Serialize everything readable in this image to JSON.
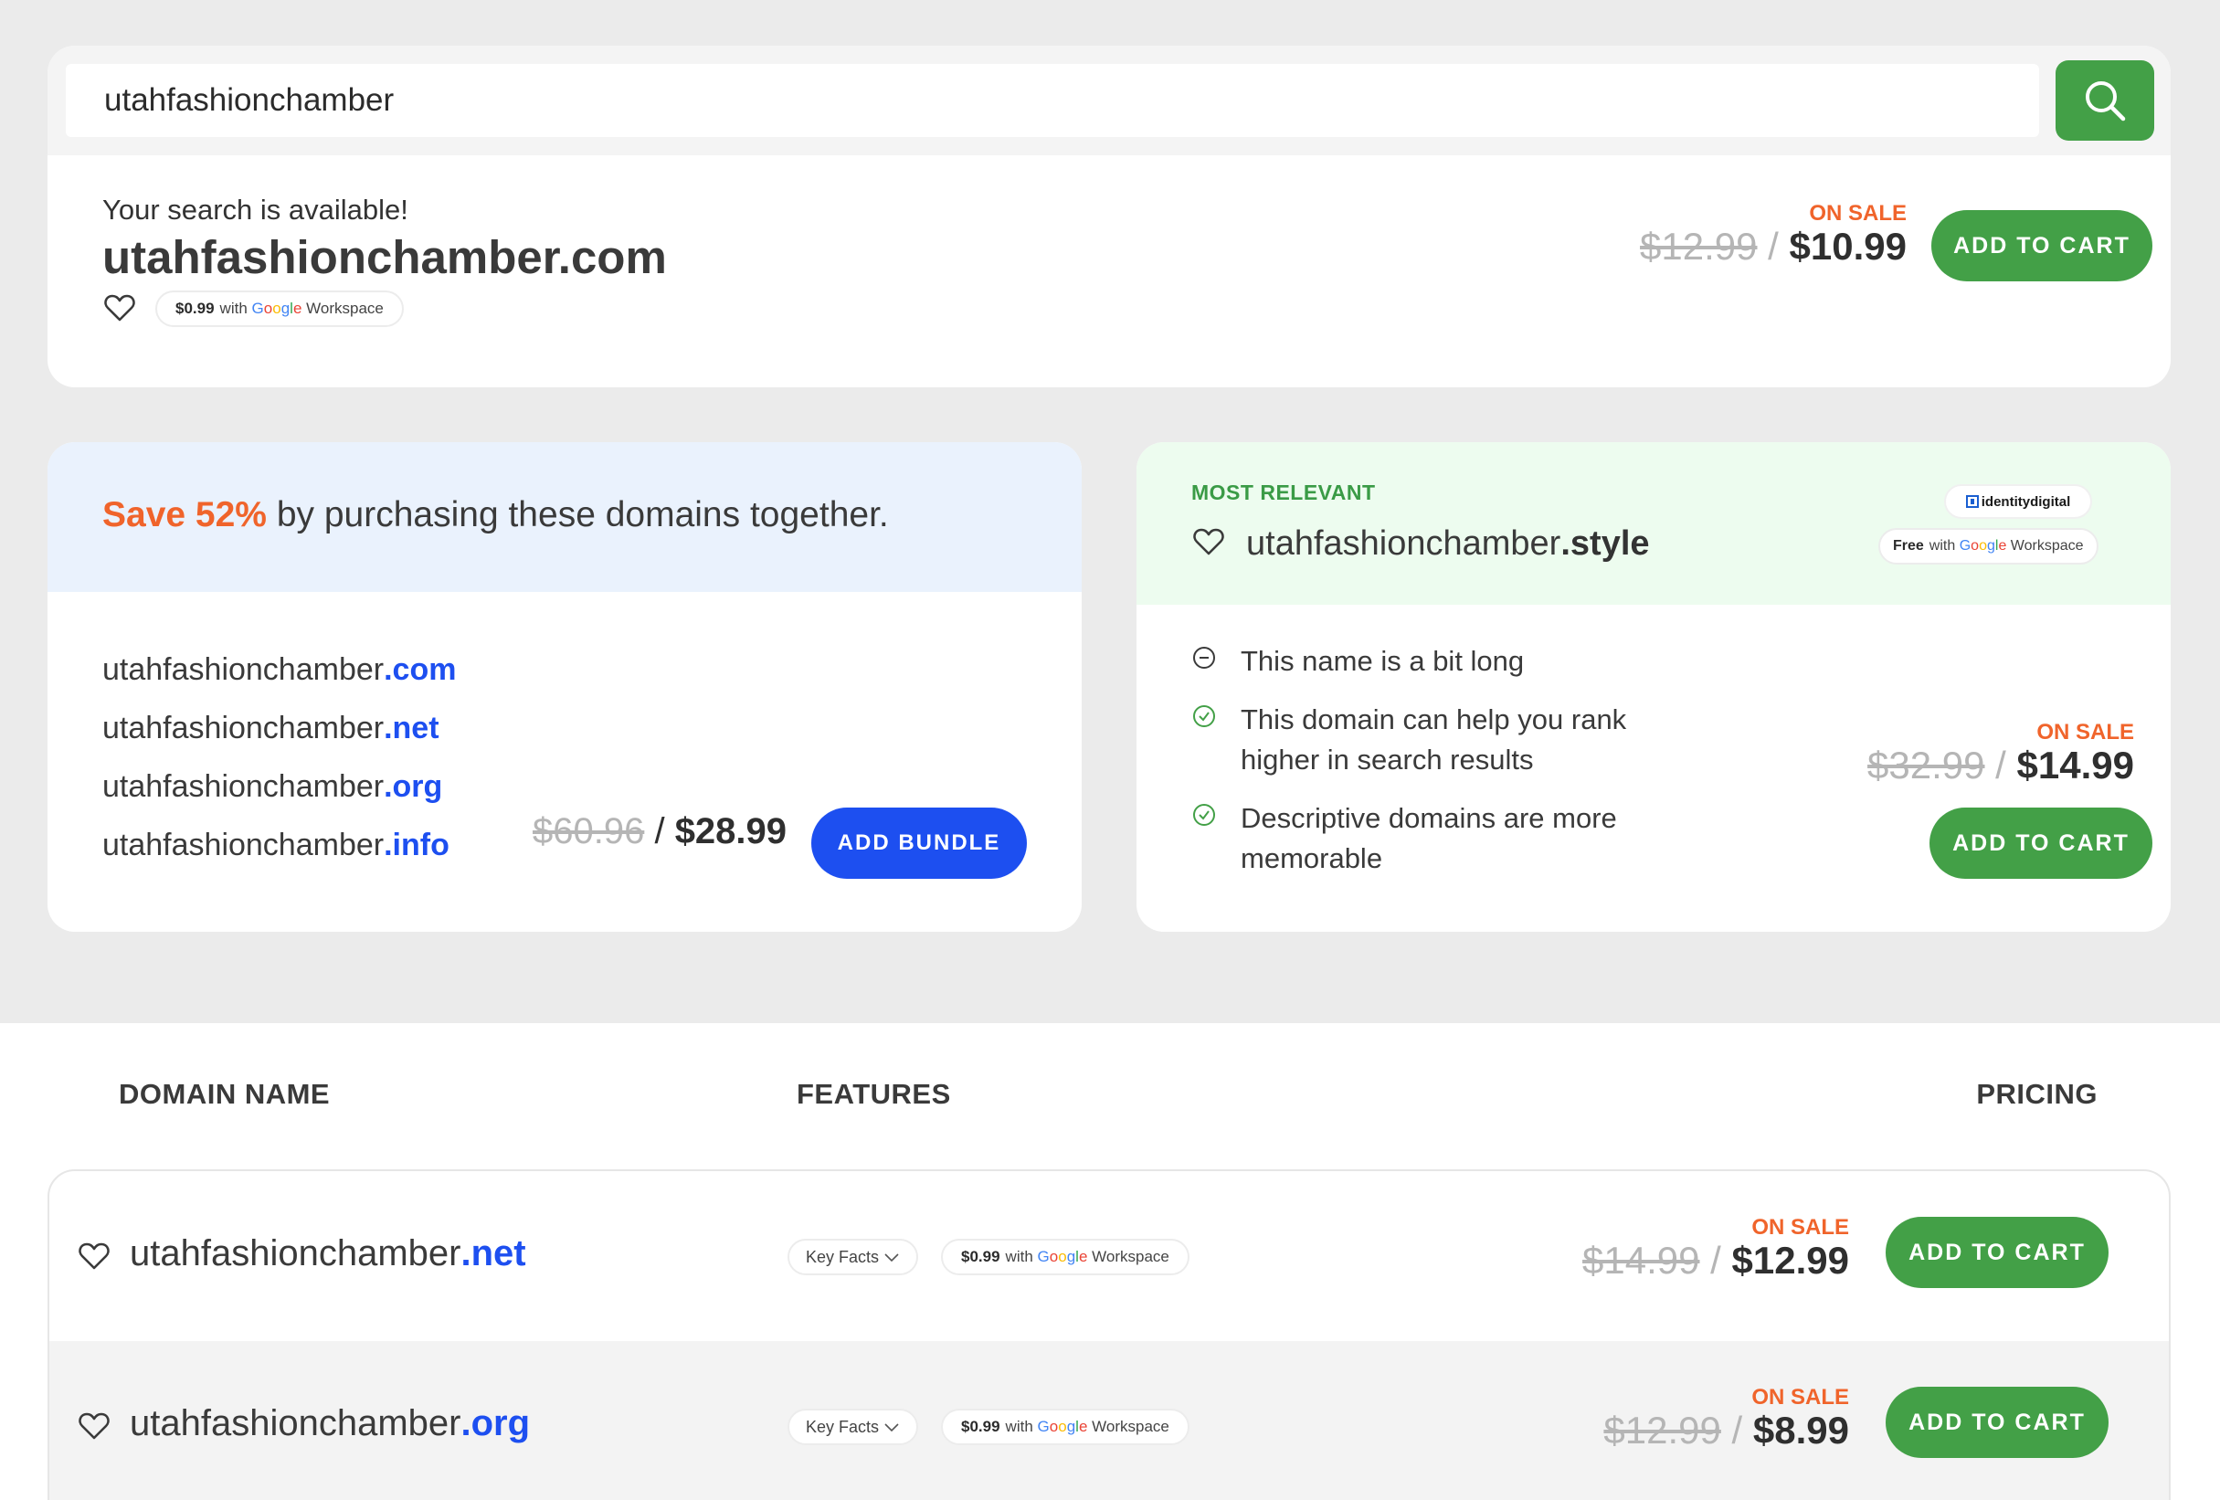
{
  "search": {
    "value": "utahfashionchamber",
    "button_icon": "search-icon"
  },
  "available": {
    "subtitle": "Your search is available!",
    "domain": "utahfashionchamber.com",
    "workspace_price": "$0.99",
    "workspace_with": "with",
    "workspace_label": "Workspace",
    "on_sale": "ON SALE",
    "old_price": "$12.99",
    "new_price": "$10.99",
    "cta": "ADD TO CART"
  },
  "bundle": {
    "save_text": "Save 52%",
    "headline_rest": " by purchasing these domains together.",
    "sld": "utahfashionchamber",
    "tlds": [
      ".com",
      ".net",
      ".org",
      ".info"
    ],
    "old_price": "$60.96",
    "new_price": "$28.99",
    "cta": "ADD BUNDLE"
  },
  "relevant": {
    "label": "MOST RELEVANT",
    "sld": "utahfashionchamber",
    "tld": ".style",
    "registry": "identitydigital",
    "workspace_price": "Free",
    "workspace_with": "with",
    "workspace_label": "Workspace",
    "facts": [
      {
        "icon": "minus-circle-icon",
        "text": "This name is a bit long"
      },
      {
        "icon": "check-circle-icon",
        "text": "This domain can help you rank higher in search results"
      },
      {
        "icon": "check-circle-icon",
        "text": "Descriptive domains are more memorable"
      }
    ],
    "on_sale": "ON SALE",
    "old_price": "$32.99",
    "new_price": "$14.99",
    "cta": "ADD TO CART"
  },
  "table": {
    "col_domain": "DOMAIN NAME",
    "col_features": "FEATURES",
    "col_pricing": "PRICING",
    "rows": [
      {
        "sld": "utahfashionchamber",
        "tld": ".net",
        "key_facts": "Key Facts",
        "ws_price": "$0.99",
        "ws_with": "with",
        "ws_label": "Workspace",
        "on_sale": "ON SALE",
        "old_price": "$14.99",
        "new_price": "$12.99",
        "cta": "ADD TO CART"
      },
      {
        "sld": "utahfashionchamber",
        "tld": ".org",
        "key_facts": "Key Facts",
        "ws_price": "$0.99",
        "ws_with": "with",
        "ws_label": "Workspace",
        "on_sale": "ON SALE",
        "old_price": "$12.99",
        "new_price": "$8.99",
        "cta": "ADD TO CART"
      }
    ]
  },
  "google": "Google",
  "colors": {
    "green": "#43a047",
    "blue": "#1d4ff0",
    "orange": "#f0642b"
  }
}
